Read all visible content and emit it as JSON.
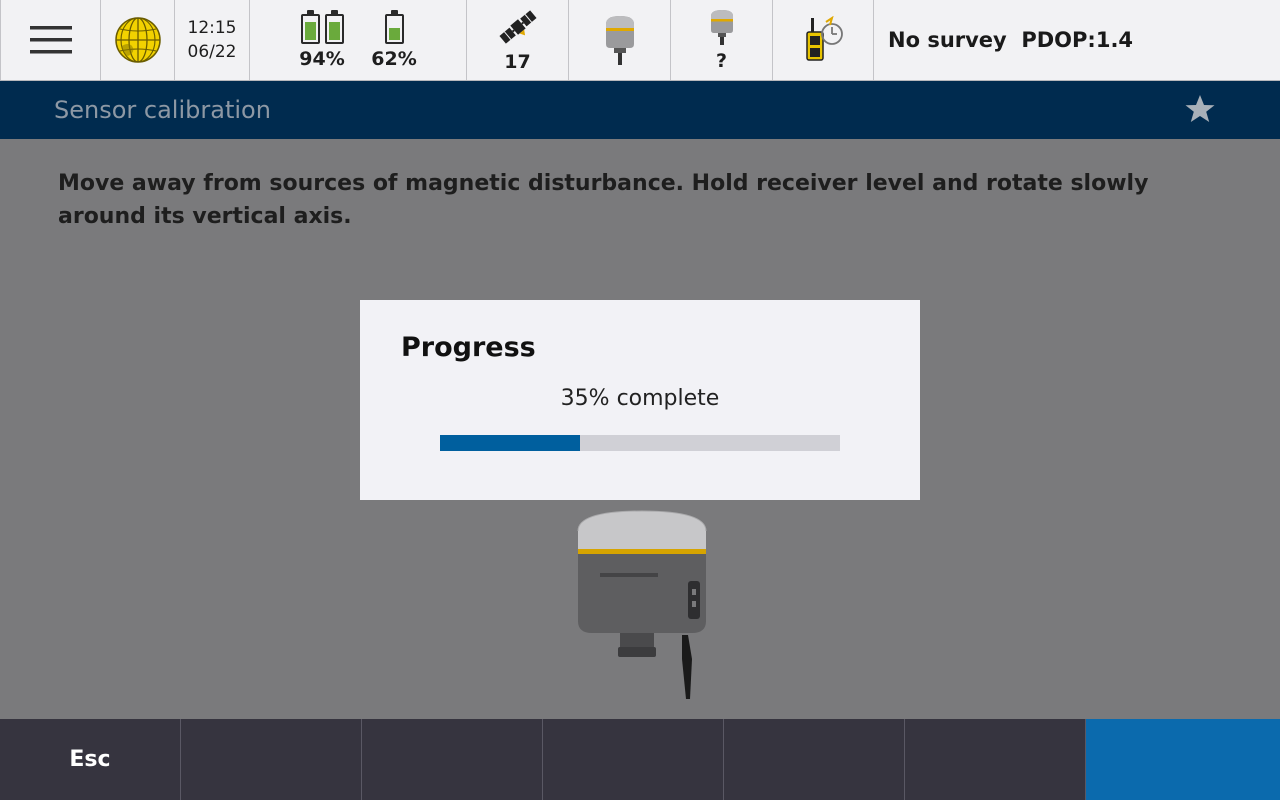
{
  "status_bar": {
    "time": "12:15",
    "date": "06/22",
    "battery_controller": "94%",
    "battery_receiver": "62%",
    "battery_controller_fill": [
      0.85,
      0.85
    ],
    "battery_receiver_fill": 0.62,
    "satellites": "17",
    "receiver2_label": "?",
    "survey_status": "No survey  PDOP:1.4"
  },
  "title_bar": {
    "title": "Sensor calibration"
  },
  "main": {
    "instructions": "Move away from sources of magnetic disturbance. Hold receiver level and rotate slowly around its vertical axis."
  },
  "dialog": {
    "title": "Progress",
    "progress_text": "35% complete",
    "progress_value": 0.35
  },
  "softkeys": {
    "keys": [
      "Esc",
      "",
      "",
      "",
      "",
      "",
      ""
    ]
  },
  "colors": {
    "title_bar_bg": "#002b4f",
    "accent_blue": "#0b6aad",
    "progress_fill": "#005f9e",
    "battery_green": "#6aaa3c",
    "globe_yellow": "#f2d200",
    "receiver_band": "#e0a800"
  },
  "icons": {
    "menu": "hamburger-menu-icon",
    "globe": "globe-icon",
    "satellite": "satellite-icon",
    "receiver": "gnss-receiver-icon",
    "controller": "controller-icon",
    "favorite": "star-icon"
  }
}
